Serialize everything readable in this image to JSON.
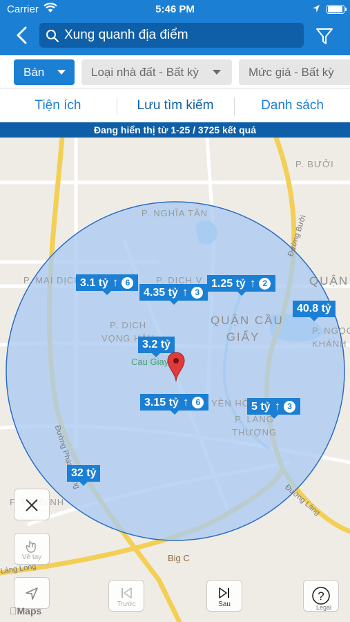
{
  "status_bar": {
    "carrier": "Carrier",
    "time": "5:46 PM",
    "battery_level": 0.92
  },
  "header": {
    "search_placeholder": "Xung quanh địa điểm"
  },
  "filters": {
    "transaction": "Bán",
    "property_type": "Loại nhà đất - Bất kỳ",
    "price": "Mức giá - Bất kỳ"
  },
  "tabs": [
    "Tiện ích",
    "Lưu tìm kiếm",
    "Danh sách"
  ],
  "results_text": "Đang hiển thị từ 1-25 / 3725 kết quả",
  "map": {
    "areas": {
      "buoi": "P. BƯỞI",
      "nghia_tan": "P. NGHĨA TÂN",
      "mai_dich": "P. MAI DỊCH",
      "dich_vong": "P. DỊCH V",
      "dich_vong_hau": "P. DỊCH\nVỌNG HẬU",
      "quan_cau_giay": "QUẬN CẦU\nGIẤY",
      "quan": "QUẬN",
      "ngoc_khanh": "P. NGỌC\nKHÁNH",
      "yen_hoa": "YÊN HÒA",
      "lang_thuong": "P. LÁNG\nTHƯỢNG",
      "my_dinh": "P. MỸ ĐÌNH"
    },
    "roads": {
      "buoi": "Đường Bưởi",
      "pham_hung": "Đường Phạm Hùng",
      "lang": "Đường Láng",
      "lang_long": "Láng Long"
    },
    "park": "Cau Giay P...",
    "poi": "Big C",
    "listings": [
      {
        "price": "3.1 tỷ",
        "count": "6"
      },
      {
        "price": "4.35 tỷ",
        "count": "3"
      },
      {
        "price": "1.25 tỷ",
        "count": "2"
      },
      {
        "price": "40.8 tỷ",
        "count": ""
      },
      {
        "price": "3.2 tỷ",
        "count": ""
      },
      {
        "price": "3.15 tỷ",
        "count": "6"
      },
      {
        "price": "5 tỷ",
        "count": "3"
      },
      {
        "price": "32 tỷ",
        "count": ""
      }
    ],
    "buttons": {
      "draw": "Vẽ tay",
      "prev": "Trước",
      "next": "Sau"
    },
    "attribution": "Maps",
    "legal": "Legal"
  },
  "colors": {
    "primary": "#1b7fd4",
    "dark": "#0e5fa7",
    "radius_fill": "#aacbf2"
  }
}
